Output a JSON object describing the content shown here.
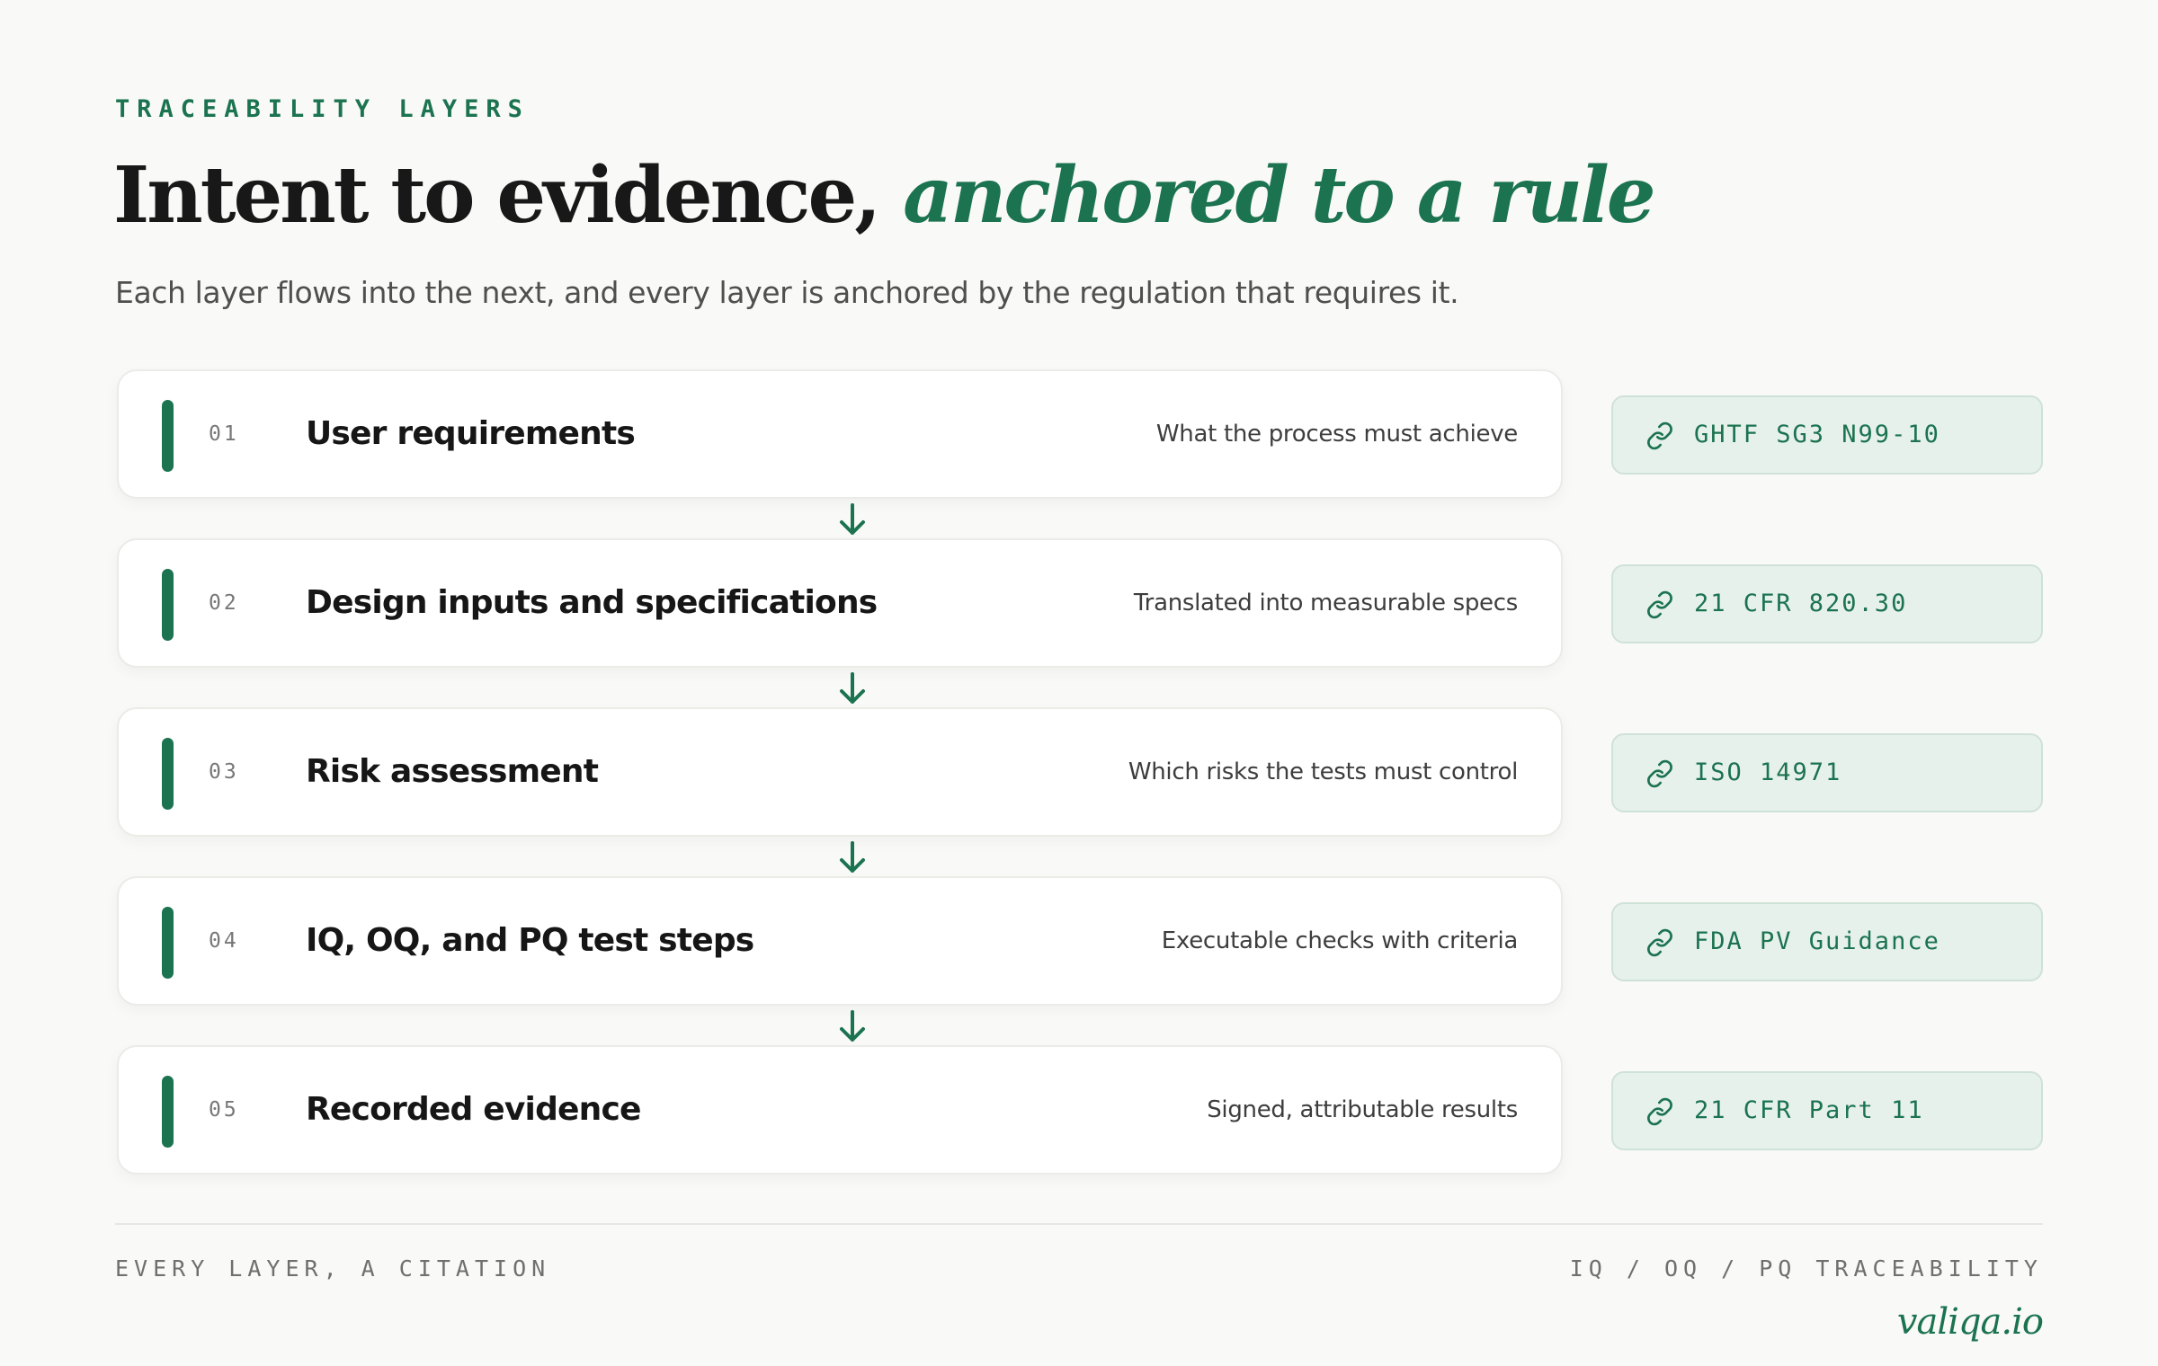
{
  "header": {
    "eyebrow": "TRACEABILITY LAYERS",
    "title_plain": "Intent to evidence, ",
    "title_accent": "anchored to a rule",
    "subtitle": "Each layer flows into the next, and every layer is anchored by the regulation that requires it."
  },
  "layers": [
    {
      "number": "01",
      "name": "User requirements",
      "description": "What the process must achieve",
      "citation": "GHTF SG3 N99-10"
    },
    {
      "number": "02",
      "name": "Design inputs and specifications",
      "description": "Translated into measurable specs",
      "citation": "21 CFR 820.30"
    },
    {
      "number": "03",
      "name": "Risk assessment",
      "description": "Which risks the tests must control",
      "citation": "ISO 14971"
    },
    {
      "number": "04",
      "name": "IQ, OQ, and PQ test steps",
      "description": "Executable checks with criteria",
      "citation": "FDA PV Guidance"
    },
    {
      "number": "05",
      "name": "Recorded evidence",
      "description": "Signed, attributable results",
      "citation": "21 CFR Part 11"
    }
  ],
  "icons": {
    "flow_arrow": "arrow-down-icon",
    "citation": "link-icon"
  },
  "footer": {
    "left": "EVERY LAYER, A CITATION",
    "right": "IQ / OQ / PQ TRACEABILITY",
    "brand": "valiqa.io"
  },
  "colors": {
    "accent": "#1b7350",
    "chip_background": "#e7f1ec",
    "page_background": "#f9f9f7"
  }
}
